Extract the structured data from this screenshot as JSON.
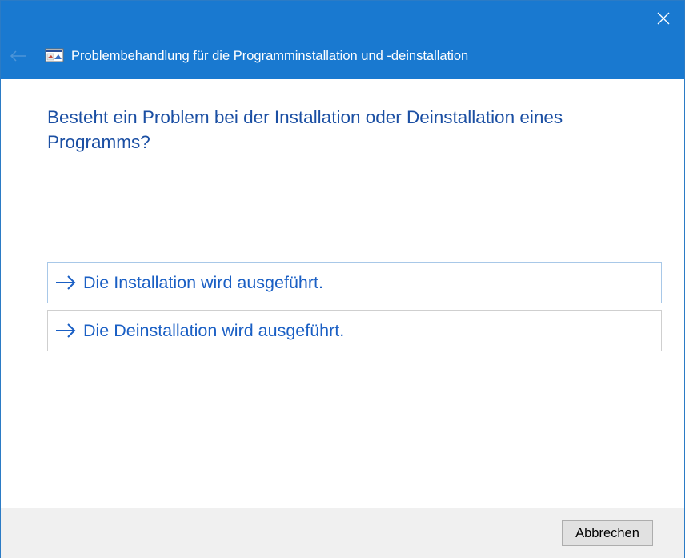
{
  "window": {
    "title": "Problembehandlung für die Programminstallation und -deinstallation",
    "accent_color": "#1979d0"
  },
  "titlebar": {
    "back_icon": "back-arrow-icon",
    "app_icon": "troubleshooter-app-icon",
    "close_icon": "close-icon"
  },
  "main": {
    "question": "Besteht ein Problem bei der Installation oder Deinstallation eines Programms?",
    "options": [
      {
        "label": "Die Installation wird ausgeführt.",
        "icon": "right-arrow-icon"
      },
      {
        "label": "Die Deinstallation wird ausgeführt.",
        "icon": "right-arrow-icon"
      }
    ]
  },
  "footer": {
    "cancel_label": "Abbrechen"
  }
}
